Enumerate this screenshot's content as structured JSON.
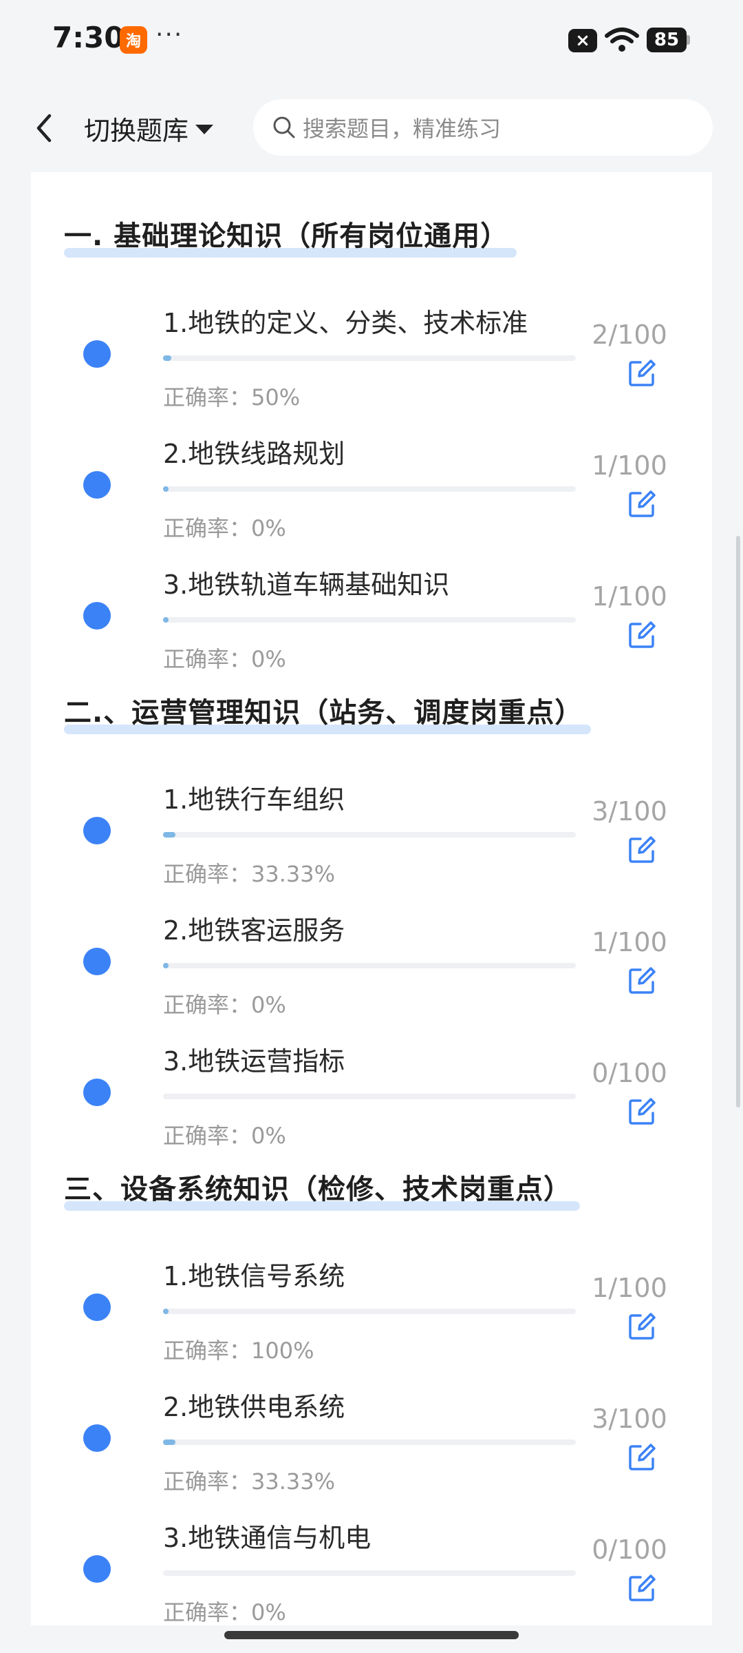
{
  "status_bar": {
    "time": "7:30",
    "app_icon_label": "淘",
    "more": "···",
    "close_badge": "×",
    "battery": "85"
  },
  "nav": {
    "switch_bank_label": "切换题库",
    "search_placeholder": "搜索题目，精准练习"
  },
  "sections": [
    {
      "title": "一. 基础理论知识（所有岗位通用）",
      "items": [
        {
          "name": "1.地铁的定义、分类、技术标准",
          "accuracy": "正确率：50%",
          "count": "2/100",
          "progress": 0.02
        },
        {
          "name": "2.地铁线路规划",
          "accuracy": "正确率：0%",
          "count": "1/100",
          "progress": 0.01
        },
        {
          "name": "3.地铁轨道车辆基础知识",
          "accuracy": "正确率：0%",
          "count": "1/100",
          "progress": 0.01
        }
      ]
    },
    {
      "title": "二.、运营管理知识（站务、调度岗重点）",
      "items": [
        {
          "name": "1.地铁行车组织",
          "accuracy": "正确率：33.33%",
          "count": "3/100",
          "progress": 0.03
        },
        {
          "name": "2.地铁客运服务",
          "accuracy": "正确率：0%",
          "count": "1/100",
          "progress": 0.01
        },
        {
          "name": "3.地铁运营指标",
          "accuracy": "正确率：0%",
          "count": "0/100",
          "progress": 0.0
        }
      ]
    },
    {
      "title": "三、设备系统知识（检修、技术岗重点）",
      "items": [
        {
          "name": "1.地铁信号系统",
          "accuracy": "正确率：100%",
          "count": "1/100",
          "progress": 0.01
        },
        {
          "name": "2.地铁供电系统",
          "accuracy": "正确率：33.33%",
          "count": "3/100",
          "progress": 0.03
        },
        {
          "name": "3.地铁通信与机电",
          "accuracy": "正确率：0%",
          "count": "0/100",
          "progress": 0.0
        }
      ]
    }
  ],
  "colors": {
    "accent": "#3b82f6",
    "progress_fill": "#7fb7e6",
    "title_underline": "#d5e6fb"
  }
}
